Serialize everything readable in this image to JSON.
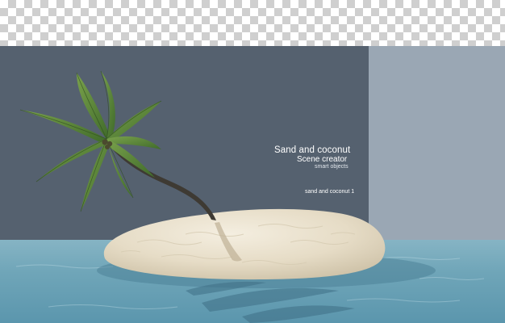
{
  "text": {
    "title": "Sand and coconut",
    "subtitle": "Scene creator",
    "caption": "smart objects",
    "label": "sand and coconut 1"
  },
  "colors": {
    "backdrop_dark": "#55616f",
    "backdrop_light": "#9aa7b4",
    "water": "#6fa5b8",
    "sand": "#ece4d2",
    "palm_leaf": "#5f8a3a",
    "trunk": "#3e3a33"
  },
  "scene": {
    "elements": [
      "transparency-checkerboard",
      "sand-island",
      "coconut-palm",
      "water",
      "palm-shadow"
    ]
  }
}
